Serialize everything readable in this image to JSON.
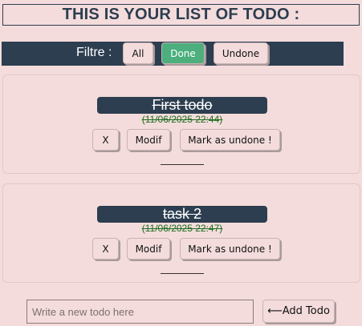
{
  "header": {
    "title": "THIS IS YOUR LIST OF TODO :"
  },
  "filter": {
    "label": "Filtre :",
    "buttons": [
      {
        "label": "All"
      },
      {
        "label": "Done"
      },
      {
        "label": "Undone"
      }
    ]
  },
  "todos": [
    {
      "title": "First todo",
      "date": "(11/06/2025 22:44)",
      "delete_label": "X",
      "edit_label": "Modif",
      "toggle_label": "Mark as undone !"
    },
    {
      "title": "task 2",
      "date": "(11/06/2025 22:47)",
      "delete_label": "X",
      "edit_label": "Modif",
      "toggle_label": "Mark as undone !"
    }
  ],
  "new_todo": {
    "placeholder": "Write a new todo here",
    "add_label": "⟵Add Todo"
  },
  "colors": {
    "background": "#f4dcdc",
    "dark": "#2c3e50",
    "active_filter": "#4caf7d",
    "date": "#1e6e1e"
  }
}
